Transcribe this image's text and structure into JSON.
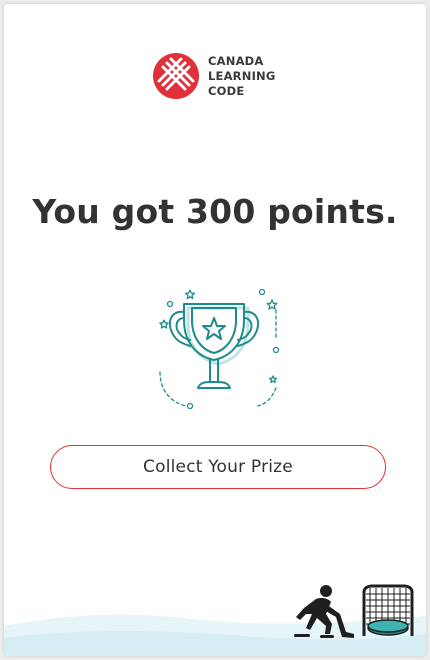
{
  "brand": {
    "name_lines": [
      "CANADA",
      "LEARNING",
      "CODE"
    ],
    "accent_color": "#e0303a",
    "logo_icon": "canada-learning-code-logo-icon"
  },
  "result": {
    "title": "You got 300 points.",
    "points": 300
  },
  "trophy": {
    "icon": "trophy-icon",
    "color": "#1e8c8c"
  },
  "cta": {
    "label": "Collect Your Prize"
  },
  "footer": {
    "icons": [
      "hockey-player-icon",
      "hockey-net-icon"
    ]
  }
}
